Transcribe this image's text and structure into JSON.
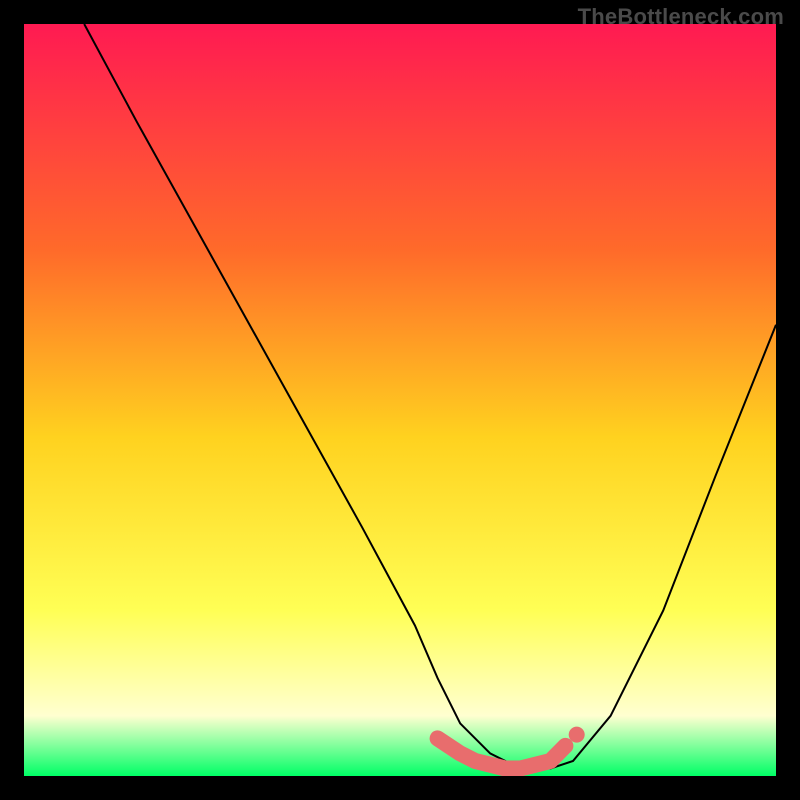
{
  "watermark": "TheBottleneck.com",
  "colors": {
    "gradient_top": "#ff1a52",
    "gradient_mid1": "#ff6a2a",
    "gradient_mid2": "#ffd21f",
    "gradient_mid3": "#ffff55",
    "gradient_mid4": "#ffffd0",
    "gradient_bottom": "#00ff66",
    "curve": "#000000",
    "marker": "#e86d6d",
    "frame": "#000000"
  },
  "chart_data": {
    "type": "line",
    "title": "",
    "xlabel": "",
    "ylabel": "",
    "xlim": [
      0,
      100
    ],
    "ylim": [
      0,
      100
    ],
    "series": [
      {
        "name": "bottleneck-curve",
        "x": [
          8,
          15,
          25,
          35,
          45,
          52,
          55,
          58,
          62,
          66,
          70,
          73,
          78,
          85,
          92,
          100
        ],
        "y": [
          100,
          87,
          69,
          51,
          33,
          20,
          13,
          7,
          3,
          1,
          1,
          2,
          8,
          22,
          40,
          60
        ]
      }
    ],
    "markers": [
      {
        "name": "flat-region",
        "x": [
          55,
          58,
          60,
          62,
          64,
          66,
          68,
          70,
          72
        ],
        "y": [
          5,
          3,
          2,
          1.5,
          1,
          1,
          1.5,
          2,
          4
        ]
      },
      {
        "name": "isolated-marker",
        "x": [
          73.5
        ],
        "y": [
          5.5
        ]
      }
    ],
    "annotations": []
  }
}
